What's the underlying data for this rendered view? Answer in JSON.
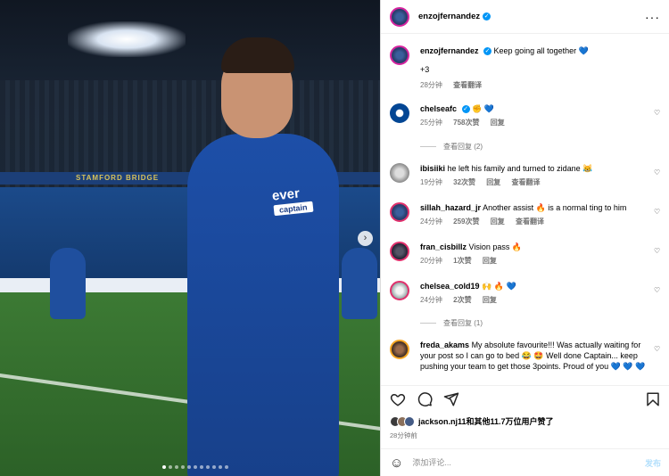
{
  "photo": {
    "sponsor": "ever",
    "armband": "captain",
    "banner": "STAMFORD BRIDGE",
    "next_icon": "›",
    "dot_count": 11,
    "active_dot": 0
  },
  "header": {
    "username": "enzojfernandez",
    "verified_icon": "✓",
    "more_icon": "···"
  },
  "caption": {
    "username": "enzojfernandez",
    "text": "Keep going all together",
    "emoji": "💙",
    "extra": "+3",
    "time": "28分钟",
    "translate": "查看翻译"
  },
  "comments": [
    {
      "username": "chelseafc",
      "verified": true,
      "text": "✊ 💙",
      "time": "25分钟",
      "likes": "758次赞",
      "reply": "回复",
      "view_replies": "查看回复 (2)"
    },
    {
      "username": "ibisiiki",
      "verified": false,
      "text": "he left his family and turned to zidane 😹",
      "time": "19分钟",
      "likes": "32次赞",
      "reply": "回复",
      "translate": "查看翻译"
    },
    {
      "username": "sillah_hazard_jr",
      "verified": false,
      "text": "Another assist 🔥 is a normal ting to him",
      "time": "24分钟",
      "likes": "259次赞",
      "reply": "回复",
      "translate": "查看翻译"
    },
    {
      "username": "fran_cisbillz",
      "verified": false,
      "text": "Vision pass 🔥",
      "time": "20分钟",
      "likes": "1次赞",
      "reply": "回复"
    },
    {
      "username": "chelsea_cold19",
      "verified": false,
      "text": "🙌 🔥 💙",
      "time": "24分钟",
      "likes": "2次赞",
      "reply": "回复",
      "view_replies": "查看回复 (1)"
    },
    {
      "username": "freda_akams",
      "verified": false,
      "text": "My absolute favourite!!! Was actually waiting for your post so I can go to bed 😂 🤩 Well done Captain... keep pushing your team to get those 3points. Proud of you 💙 💙 💙"
    }
  ],
  "likes": {
    "text": "jackson.nj11和其他11.7万位用户赞了"
  },
  "time_ago": "28分钟前",
  "composer": {
    "emoji_icon": "☺",
    "placeholder": "添加评论...",
    "post": "发布"
  }
}
